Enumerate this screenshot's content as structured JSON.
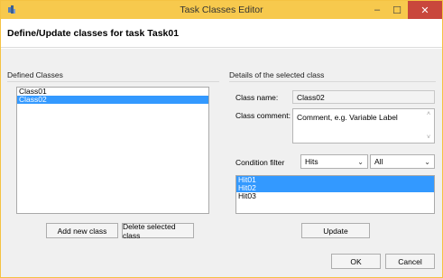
{
  "window": {
    "title": "Task Classes Editor",
    "minimize_glyph": "–",
    "maximize_glyph": "☐",
    "close_glyph": "✕",
    "accent_color": "#f7c94d",
    "close_color": "#c9473c"
  },
  "header": {
    "title": "Define/Update classes for task Task01"
  },
  "left": {
    "section_label": "Defined Classes",
    "classes": [
      {
        "label": "Class01",
        "selected": false
      },
      {
        "label": "Class02",
        "selected": true
      }
    ],
    "add_button": "Add new class",
    "delete_button": "Delete selected class"
  },
  "right": {
    "section_label": "Details of the selected class",
    "class_name_label": "Class name:",
    "class_name_value": "Class02",
    "class_comment_label": "Class comment:",
    "class_comment_value": "Comment, e.g. Variable Label",
    "condition_filter_label": "Condition filter",
    "filter_type": "Hits",
    "filter_scope": "All",
    "hits": [
      {
        "label": "Hit01",
        "selected": true
      },
      {
        "label": "Hit02",
        "selected": true
      },
      {
        "label": "Hit03",
        "selected": false
      }
    ],
    "update_button": "Update"
  },
  "footer": {
    "ok_button": "OK",
    "cancel_button": "Cancel"
  },
  "selection_color": "#3399ff"
}
